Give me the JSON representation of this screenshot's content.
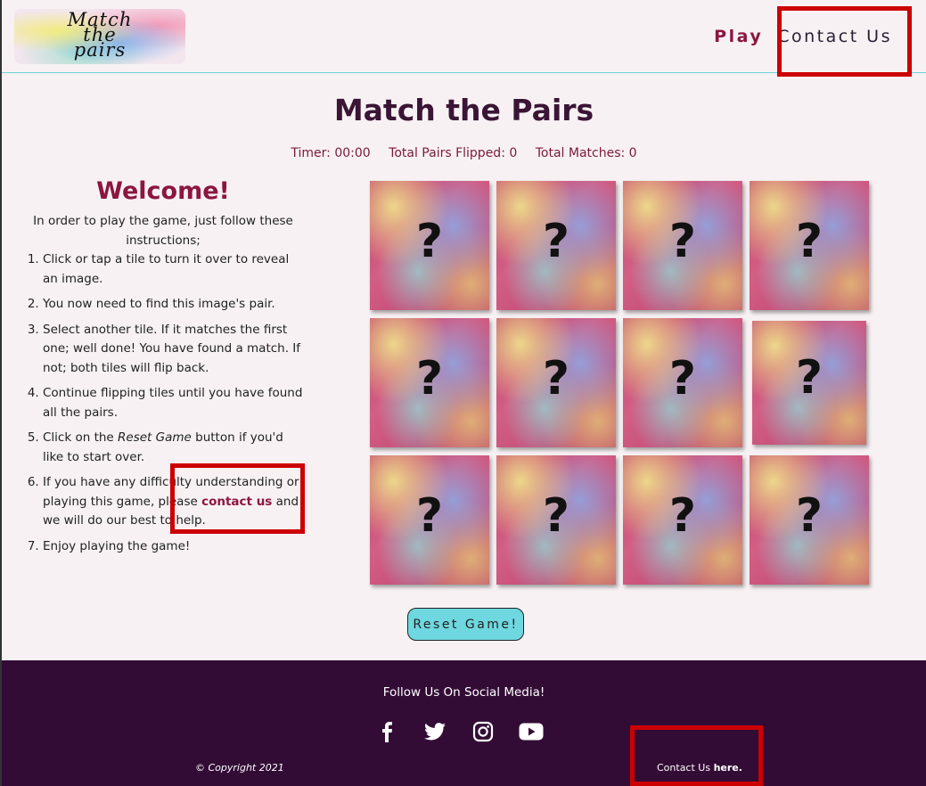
{
  "header": {
    "logo_lines": [
      "Match",
      "the",
      "pairs"
    ],
    "nav": {
      "play": "Play",
      "contact": "Contact Us"
    }
  },
  "main": {
    "title": "Match the Pairs",
    "stats": {
      "timer": "Timer: 00:00",
      "pairs_flipped": "Total Pairs Flipped: 0",
      "matches": "Total Matches: 0"
    },
    "welcome": {
      "title": "Welcome!",
      "intro": "In order to play the game, just follow these instructions;",
      "steps": [
        "Click or tap a tile to turn it over to reveal an image.",
        "You now need to find this image's pair.",
        "Select another tile. If it matches the first one; well done! You have found a match. If not; both tiles will flip back.",
        "Continue flipping tiles until you have found all the pairs.",
        {
          "before": "Click on the ",
          "em": "Reset Game",
          "after": " button if you'd like to start over."
        },
        {
          "before": "If you have any difficulty understanding or playing this game, please ",
          "link": "contact us",
          "after": " and we will do our best to help."
        },
        "Enjoy playing the game!"
      ]
    },
    "tile_symbol": "?",
    "tile_count": 12,
    "reset_label": "Reset Game!"
  },
  "footer": {
    "follow": "Follow Us On Social Media!",
    "socials": [
      "facebook-icon",
      "twitter-icon",
      "instagram-icon",
      "youtube-icon"
    ],
    "copyright": "© Copyright 2021",
    "contact_prefix": "Contact Us ",
    "contact_link": "here."
  },
  "colors": {
    "accent": "#8b1640",
    "footer_bg": "#330c36",
    "button_bg": "#6fd7df",
    "highlight": "#cc0000"
  }
}
